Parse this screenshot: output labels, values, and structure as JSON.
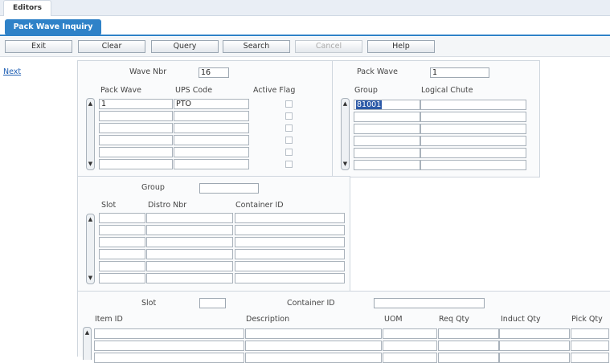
{
  "editors_tab": "Editors",
  "subtab": "Pack Wave Inquiry",
  "toolbar": {
    "exit": "Exit",
    "clear": "Clear",
    "query": "Query",
    "search": "Search",
    "cancel": "Cancel",
    "help": "Help"
  },
  "nav": {
    "next": "Next"
  },
  "wave_panel": {
    "wave_nbr_label": "Wave Nbr",
    "wave_nbr_value": "16",
    "columns": [
      "Pack Wave",
      "UPS Code",
      "Active Flag"
    ],
    "rows": [
      {
        "pack_wave": "1",
        "ups_code": "PTO"
      },
      {
        "pack_wave": "",
        "ups_code": ""
      },
      {
        "pack_wave": "",
        "ups_code": ""
      },
      {
        "pack_wave": "",
        "ups_code": ""
      },
      {
        "pack_wave": "",
        "ups_code": ""
      },
      {
        "pack_wave": "",
        "ups_code": ""
      }
    ]
  },
  "group_panel": {
    "pack_wave_label": "Pack Wave",
    "pack_wave_value": "1",
    "columns": [
      "Group",
      "Logical Chute"
    ],
    "rows": [
      {
        "group": "81001",
        "chute": ""
      },
      {
        "group": "",
        "chute": ""
      },
      {
        "group": "",
        "chute": ""
      },
      {
        "group": "",
        "chute": ""
      },
      {
        "group": "",
        "chute": ""
      },
      {
        "group": "",
        "chute": ""
      }
    ]
  },
  "slot_panel": {
    "group_label": "Group",
    "group_value": "",
    "columns": [
      "Slot",
      "Distro Nbr",
      "Container ID"
    ]
  },
  "item_panel": {
    "slot_label": "Slot",
    "slot_value": "",
    "container_label": "Container ID",
    "container_value": "",
    "columns": [
      "Item ID",
      "Description",
      "UOM",
      "Req Qty",
      "Induct Qty",
      "Pick Qty"
    ]
  }
}
